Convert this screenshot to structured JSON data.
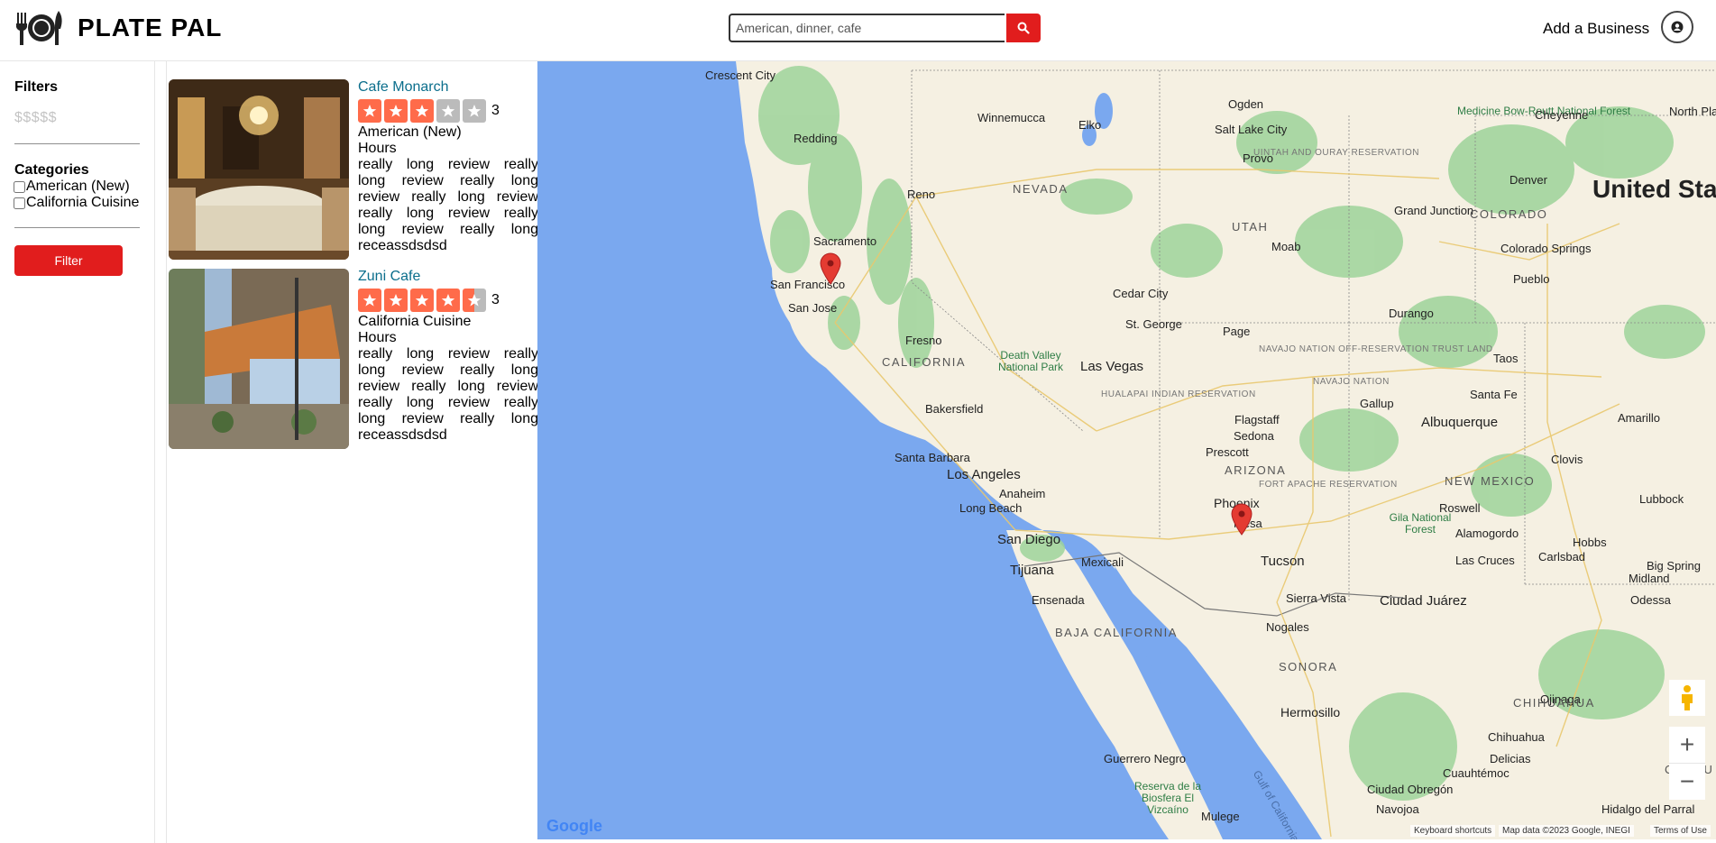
{
  "header": {
    "brand": "PLATE PAL",
    "search_placeholder": "American, dinner, cafe",
    "add_business": "Add a Business"
  },
  "sidebar": {
    "filters_title": "Filters",
    "price_label": "$$$$$",
    "categories_title": "Categories",
    "categories": [
      "American (New)",
      "California Cuisine"
    ],
    "filter_button": "Filter"
  },
  "results": [
    {
      "name": "Cafe Monarch",
      "rating": 3,
      "rating_label": "3",
      "category": "American (New)",
      "hours": "Hours",
      "review": "really long review really long review really long review really long review really long review really long review really long receassdsdsd"
    },
    {
      "name": "Zuni Cafe",
      "rating": 4.5,
      "rating_label": "3",
      "category": "California Cuisine",
      "hours": "Hours",
      "review": "really long review really long review really long review really long review really long review really long review really long receassdsdsd"
    }
  ],
  "map": {
    "country_label": "United Sta",
    "states": [
      "NEVADA",
      "UTAH",
      "COLORADO",
      "CALIFORNIA",
      "ARIZONA",
      "NEW MEXICO",
      "BAJA CALIFORNIA",
      "SONORA",
      "CHIHUAHUA",
      "COAHU"
    ],
    "cities": [
      "Crescent City",
      "Redding",
      "Winnemucca",
      "Elko",
      "Ogden",
      "Salt Lake City",
      "Provo",
      "Cheyenne",
      "Denver",
      "Reno",
      "Sacramento",
      "San Francisco",
      "San Jose",
      "Fresno",
      "Moab",
      "Grand Junction",
      "Colorado Springs",
      "Pueblo",
      "Cedar City",
      "St. George",
      "Las Vegas",
      "Page",
      "Durango",
      "Bakersfield",
      "Taos",
      "Santa Fe",
      "Gallup",
      "Flagstaff",
      "Albuquerque",
      "Amarillo",
      "Santa Barbara",
      "Los Angeles",
      "Anaheim",
      "Long Beach",
      "Prescott",
      "Sedona",
      "Phoenix",
      "Mesa",
      "Clovis",
      "Lubbock",
      "San Diego",
      "Tijuana",
      "Mexicali",
      "Tucson",
      "Roswell",
      "Alamogordo",
      "Hobbs",
      "Big Spring",
      "Midland",
      "Odessa",
      "Las Cruces",
      "Carlsbad",
      "Ensenada",
      "Sierra Vista",
      "Nogales",
      "Ciudad Juárez",
      "Hermosillo",
      "Ojinaga",
      "Chihuahua",
      "Delicias",
      "Cuauhtémoc",
      "Guerrero Negro",
      "Mulege",
      "Ciudad Obregón",
      "Navojoa",
      "Hidalgo del Parral",
      "North Pla",
      "Medicine Bow-Routt National Forest"
    ],
    "regions": [
      "UINTAH AND OURAY RESERVATION",
      "NAVAJO NATION OFF-RESERVATION TRUST LAND",
      "NAVAJO NATION",
      "HUALAPAI INDIAN RESERVATION",
      "FORT APACHE RESERVATION"
    ],
    "parks": [
      "Death Valley National Park",
      "Gila National Forest",
      "Reserva de la Biosfera El Vizcaíno",
      "Gulf of California"
    ],
    "google_logo": "Google",
    "shortcuts": "Keyboard shortcuts",
    "map_data": "Map data ©2023 Google, INEGI",
    "terms": "Terms of Use",
    "zoom_in": "+",
    "zoom_out": "−"
  },
  "colors": {
    "brand_red": "#e11d1d",
    "star_orange": "#ff6b4a",
    "star_grey": "#bbbbbb",
    "link_teal": "#0b6e8c",
    "water": "#7aa8ef",
    "land": "#f5f0e2",
    "forest": "#9dd39a"
  }
}
